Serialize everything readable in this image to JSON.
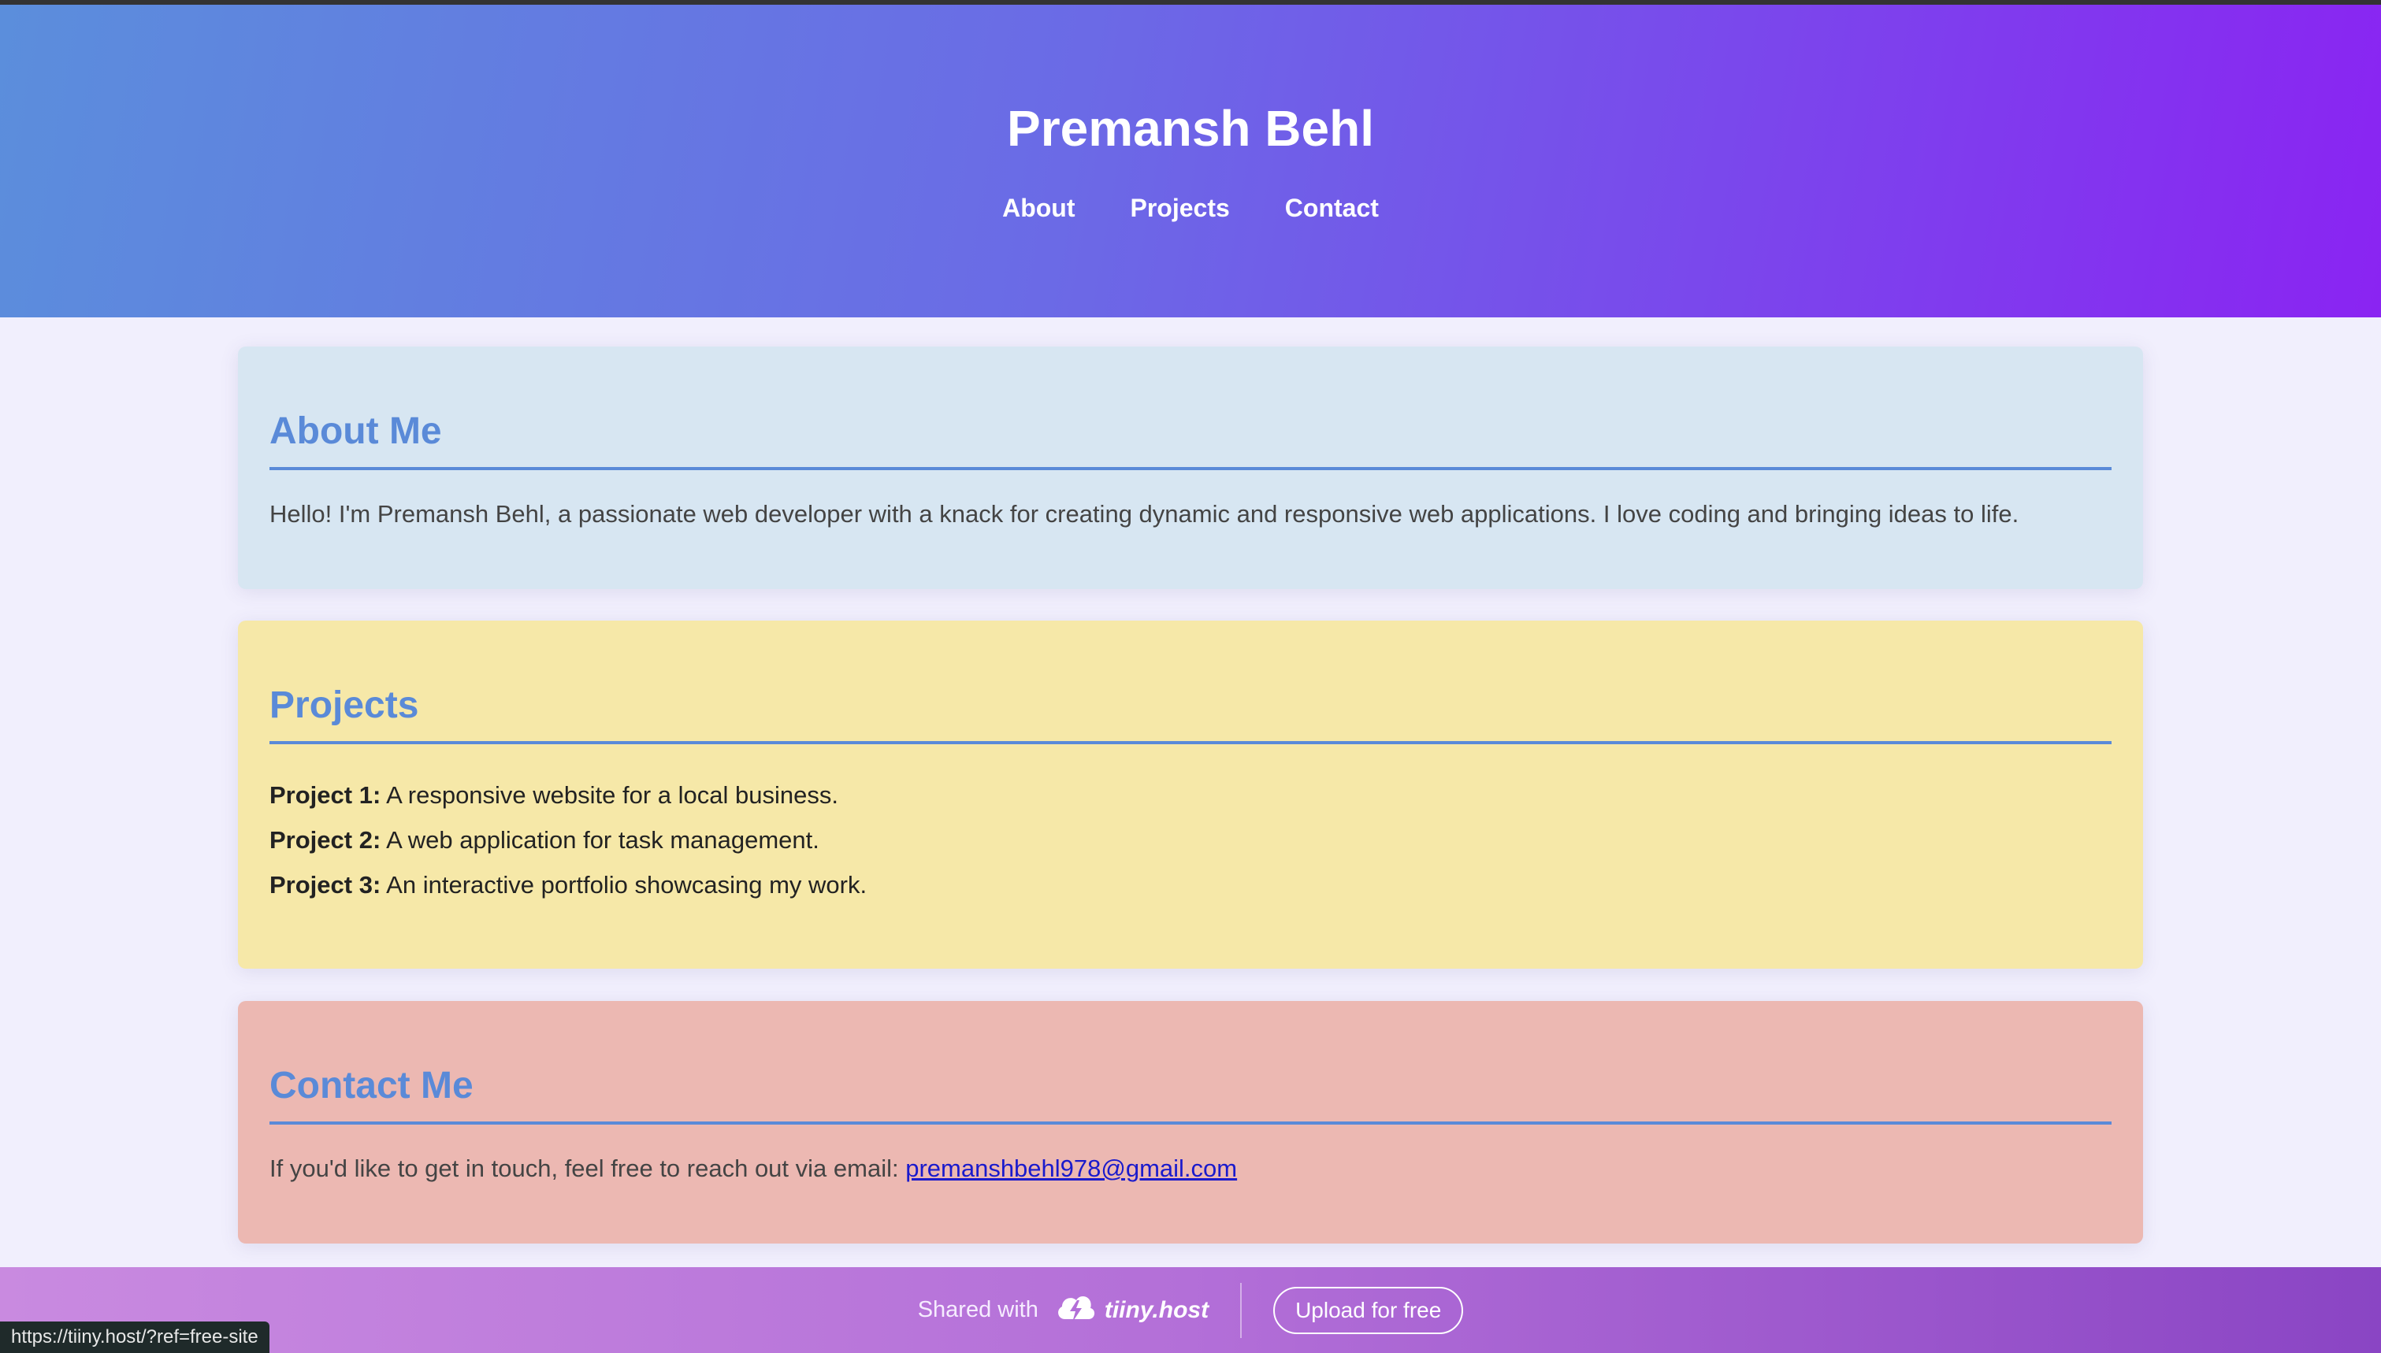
{
  "header": {
    "title": "Premansh Behl",
    "nav": [
      "About",
      "Projects",
      "Contact"
    ]
  },
  "about": {
    "heading": "About Me",
    "text": "Hello! I'm Premansh Behl, a passionate web developer with a knack for creating dynamic and responsive web applications. I love coding and bringing ideas to life."
  },
  "projects": {
    "heading": "Projects",
    "items": [
      {
        "label": "Project 1:",
        "desc": " A responsive website for a local business."
      },
      {
        "label": "Project 2:",
        "desc": " A web application for task management."
      },
      {
        "label": "Project 3:",
        "desc": " An interactive portfolio showcasing my work."
      }
    ]
  },
  "contact": {
    "heading": "Contact Me",
    "text": "If you'd like to get in touch, feel free to reach out via email: ",
    "email": "premanshbehl978@gmail.com"
  },
  "footer_bar": {
    "shared_label": "Shared with",
    "brand": "tiiny.host",
    "brand_icon": "cloud-bolt-icon",
    "upload_label": "Upload for free"
  },
  "status_bar": {
    "url": "https://tiiny.host/?ref=free-site"
  },
  "colors": {
    "header_gradient_start": "#5b8edc",
    "header_gradient_end": "#8a24f2",
    "heading_blue": "#5a8ad8",
    "about_bg": "#d7e6f2",
    "projects_bg": "#f6e8a8",
    "contact_bg": "#ecb8b2"
  }
}
